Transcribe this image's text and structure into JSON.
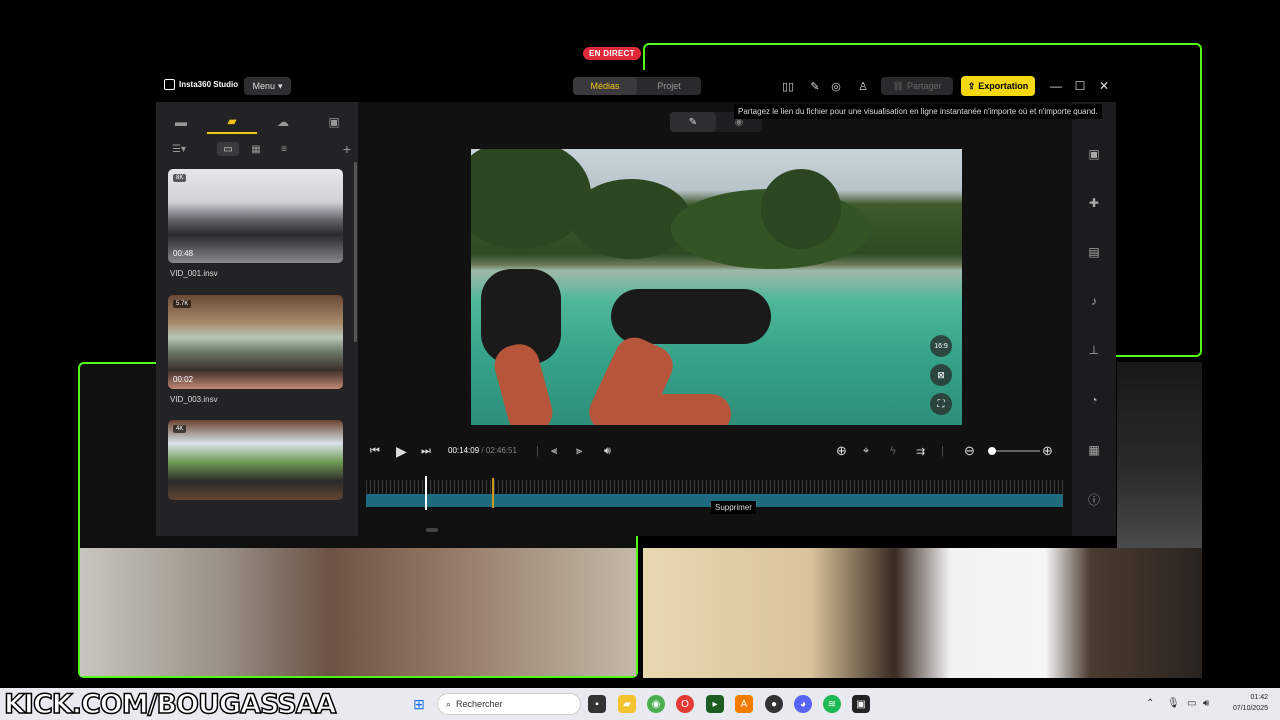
{
  "stream": {
    "live_badge": "EN DIRECT",
    "channel_text": "KICK.COM/BOUGASSAA",
    "accent_color": "#53fc18"
  },
  "app": {
    "name": "Insta360 Studio",
    "menu_label": "Menu",
    "tabs": [
      {
        "label": "Médias",
        "active": true
      },
      {
        "label": "Projet",
        "active": false
      }
    ],
    "share_label": "Partager",
    "export_label": "Exportation",
    "share_tooltip": "Partagez le lien du fichier pour une visualisation en ligne instantanée n'importe où et n'importe quand.",
    "export_color": "#f5d80f"
  },
  "media": {
    "items": [
      {
        "badge": "8K",
        "duration": "00:48",
        "name": "VID_001.insv"
      },
      {
        "badge": "5.7K",
        "duration": "00:02",
        "name": "VID_003.insv"
      },
      {
        "badge": "4K",
        "duration": "",
        "name": ""
      }
    ]
  },
  "player": {
    "aspect_label": "16:9",
    "current_time": "00:14:09",
    "separator": " / ",
    "total_time": "02:46:51",
    "playhead_fraction": 0.085,
    "delete_tooltip": "Supprimer"
  },
  "taskbar": {
    "search_placeholder": "Rechercher",
    "time": "01:42",
    "date": "07/10/2025"
  }
}
